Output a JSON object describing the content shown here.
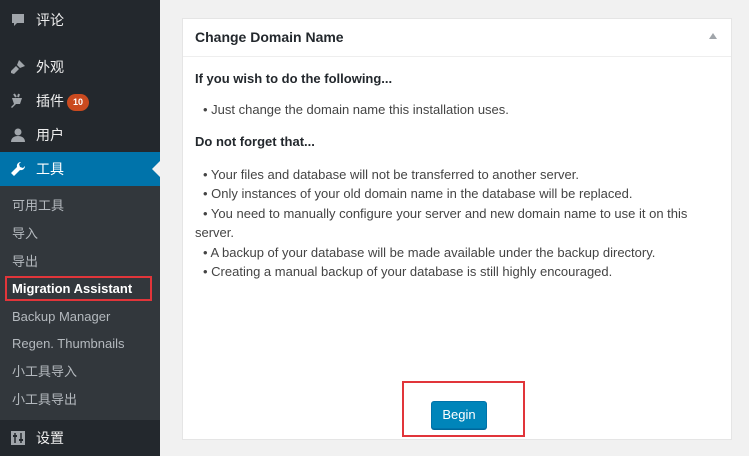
{
  "sidebar": {
    "menu": {
      "comments": "评论",
      "appearance": "外观",
      "plugins": "插件",
      "plugins_badge": "10",
      "users": "用户",
      "tools": "工具",
      "settings": "设置"
    },
    "submenu": [
      "可用工具",
      "导入",
      "导出",
      "Migration Assistant",
      "Backup Manager",
      "Regen. Thumbnails",
      "小工具导入",
      "小工具导出"
    ],
    "active_color": "#0073aa",
    "highlight_color": "#e1353a"
  },
  "panel": {
    "title": "Change Domain Name",
    "heading1": "If you wish to do the following...",
    "bullets1": [
      "• Just change the domain name this installation uses."
    ],
    "heading2": "Do not forget that...",
    "bullets2": [
      "• Your files and database will not be transferred to another server.",
      "• Only instances of your old domain name in the database will be replaced.",
      "• You need to manually configure your server and new domain name to use it on this server.",
      "• A backup of your database will be made available under the backup directory.",
      "• Creating a manual backup of your database is still highly encouraged."
    ],
    "button_label": "Begin",
    "button_color": "#0085ba"
  }
}
